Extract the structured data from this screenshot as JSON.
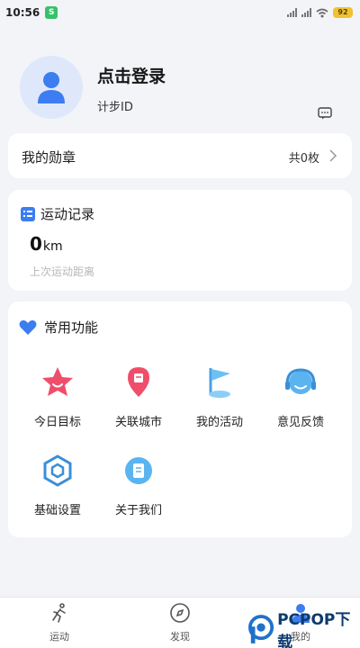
{
  "status_bar": {
    "time": "10:56",
    "app_badge": "S",
    "battery": "92"
  },
  "profile": {
    "title": "点击登录",
    "subtitle": "计步ID"
  },
  "medals": {
    "label": "我的勋章",
    "count": "共0枚"
  },
  "record": {
    "title": "运动记录",
    "value": "0",
    "unit": "km",
    "desc": "上次运动距离"
  },
  "functions": {
    "title": "常用功能",
    "items": [
      {
        "label": "今日目标",
        "icon": "star-icon"
      },
      {
        "label": "关联城市",
        "icon": "location-pin-icon"
      },
      {
        "label": "我的活动",
        "icon": "flag-icon"
      },
      {
        "label": "意见反馈",
        "icon": "headset-icon"
      },
      {
        "label": "基础设置",
        "icon": "hexagon-settings-icon"
      },
      {
        "label": "关于我们",
        "icon": "document-icon"
      }
    ]
  },
  "tabs": [
    {
      "label": "运动",
      "icon": "running-icon"
    },
    {
      "label": "发现",
      "icon": "compass-icon"
    },
    {
      "label": "我的",
      "icon": "user-icon"
    }
  ],
  "watermark": {
    "text": "PCPOP下载"
  },
  "colors": {
    "accent": "#3c7df1",
    "background": "#f3f4f8",
    "card": "#ffffff"
  }
}
